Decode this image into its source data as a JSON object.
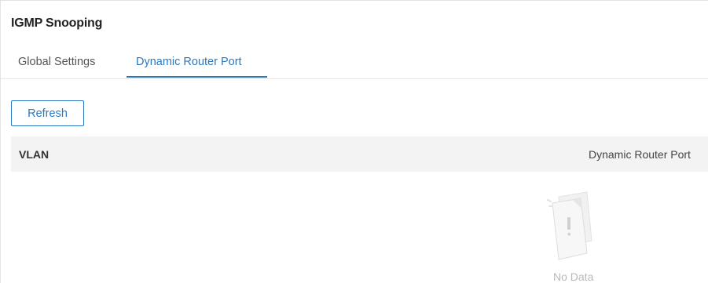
{
  "page": {
    "title": "IGMP Snooping"
  },
  "tabs": [
    {
      "label": "Global Settings",
      "active": false
    },
    {
      "label": "Dynamic Router Port",
      "active": true
    }
  ],
  "toolbar": {
    "refresh_label": "Refresh"
  },
  "table": {
    "columns": [
      "VLAN",
      "Dynamic Router Port"
    ],
    "rows": [],
    "empty_text": "No Data"
  },
  "colors": {
    "accent": "#2b78c0",
    "header_bg": "#f3f3f3",
    "muted_text": "#b9b9b9"
  },
  "icons": {
    "empty_state": "no-data-document-icon"
  }
}
